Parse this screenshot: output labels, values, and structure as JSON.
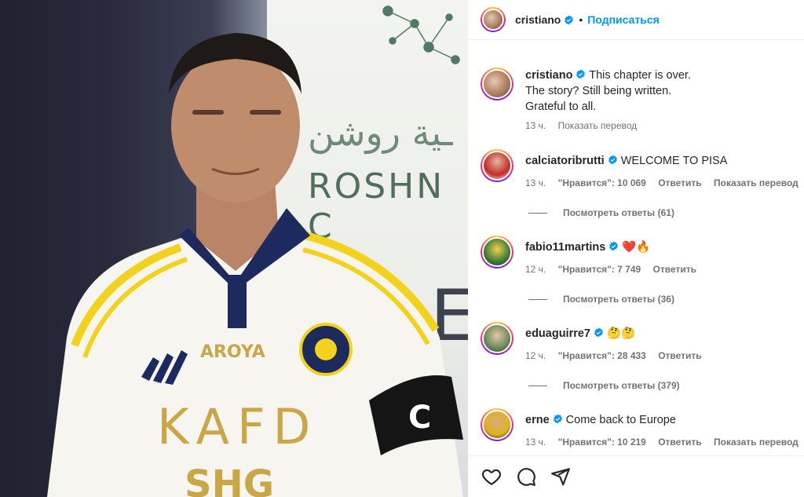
{
  "post": {
    "author": "cristiano",
    "follow_label": "Подписаться",
    "separator": "•"
  },
  "photo": {
    "arabic_text": "ـية روشن",
    "sponsor_text": "ROSHN C",
    "big_letter": "E"
  },
  "caption": {
    "username": "cristiano",
    "line1": "This chapter is over.",
    "line2": "The story? Still being written.",
    "line3": "Grateful to all.",
    "time": "13 ч.",
    "translate": "Показать перевод"
  },
  "comments": [
    {
      "username": "calciatoribrutti",
      "text": "WELCOME TO PISA",
      "time": "13 ч.",
      "likes": "\"Нравится\": 10 069",
      "reply": "Ответить",
      "translate": "Показать перевод",
      "replies": "Посмотреть ответы (61)"
    },
    {
      "username": "fabio11martins",
      "text": "❤️🔥",
      "time": "12 ч.",
      "likes": "\"Нравится\": 7 749",
      "reply": "Ответить",
      "replies": "Посмотреть ответы (36)"
    },
    {
      "username": "eduaguirre7",
      "text": "🤔🤔",
      "time": "12 ч.",
      "likes": "\"Нравится\": 28 433",
      "reply": "Ответить",
      "replies": "Посмотреть ответы (379)"
    },
    {
      "username": "erne",
      "text": "Come back to Europe",
      "time": "13 ч.",
      "likes": "\"Нравится\": 10 219",
      "reply": "Ответить",
      "translate": "Показать перевод"
    }
  ],
  "icons": {
    "like": "heart-icon",
    "comment": "comment-icon",
    "share": "share-icon",
    "verified": "verified-badge-icon"
  },
  "colors": {
    "accent": "#0095f6",
    "verified": "#0095f6",
    "muted": "#737373"
  }
}
